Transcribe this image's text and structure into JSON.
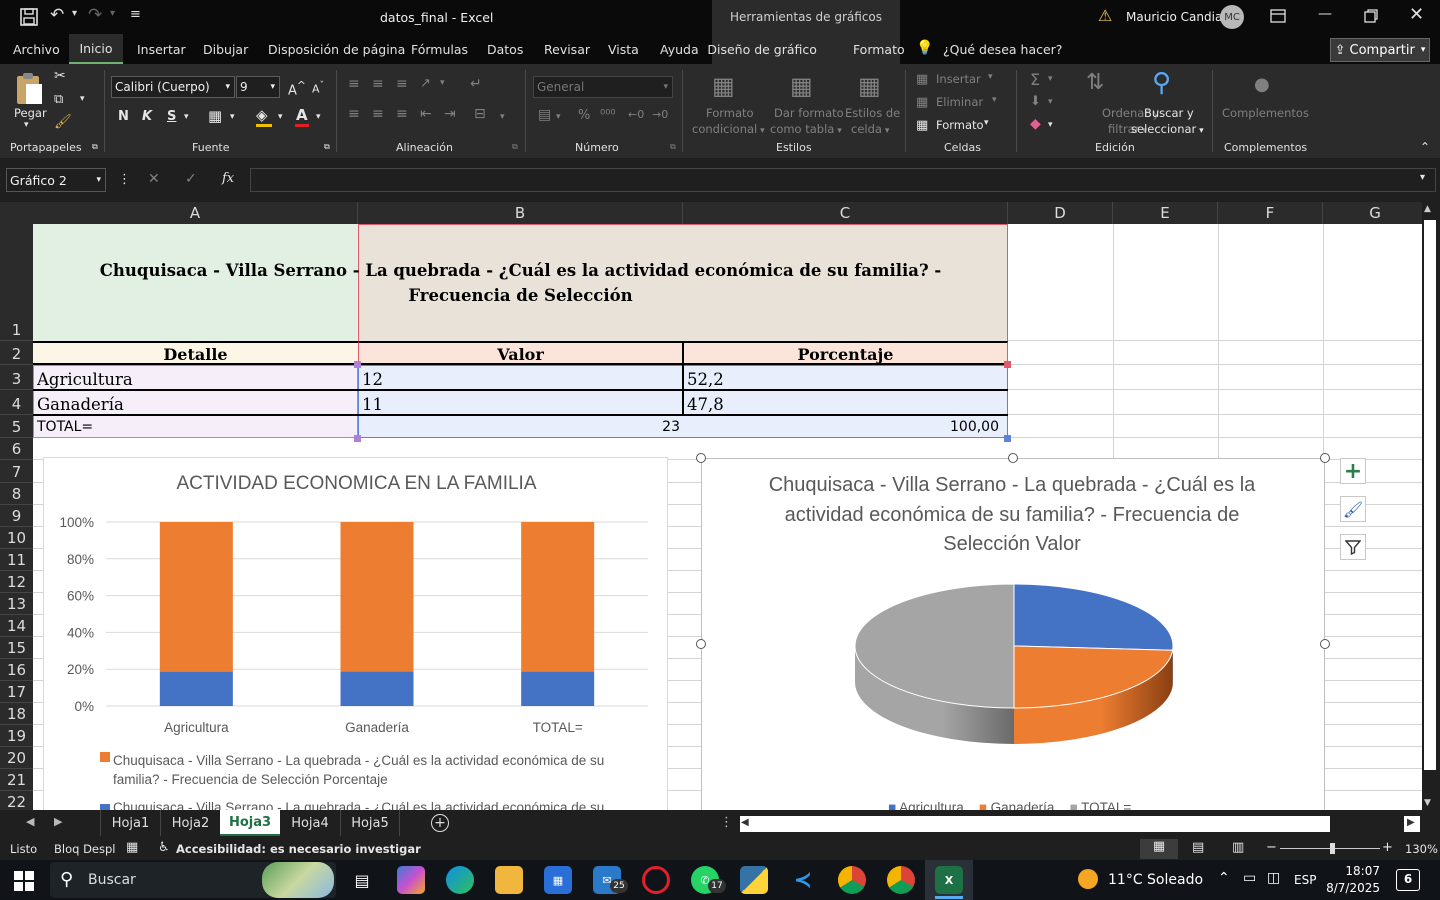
{
  "window": {
    "doc_title": "datos_final  -  Excel",
    "context_title": "Herramientas de gráficos",
    "user": "Mauricio Candia",
    "user_initials": "MC"
  },
  "tabs": [
    "Archivo",
    "Inicio",
    "Insertar",
    "Dibujar",
    "Disposición de página",
    "Fórmulas",
    "Datos",
    "Revisar",
    "Vista",
    "Ayuda",
    "Diseño de gráfico",
    "Formato"
  ],
  "tell_me": "¿Qué desea hacer?",
  "share": "Compartir",
  "ribbon": {
    "paste": "Pegar",
    "font_name": "Calibri (Cuerpo)",
    "font_size": "9",
    "bold": "N",
    "italic": "K",
    "underline": "S",
    "number_format": "General",
    "cond_format": [
      "Formato",
      "condicional"
    ],
    "format_table": [
      "Dar formato",
      "como tabla"
    ],
    "cell_styles": [
      "Estilos de",
      "celda"
    ],
    "insert": "Insertar",
    "delete": "Eliminar",
    "format": "Formato",
    "sort_filter": [
      "Ordenar y",
      "filtrar"
    ],
    "find_select": [
      "Buscar y",
      "seleccionar"
    ],
    "addins": "Complementos",
    "groups": [
      "Portapapeles",
      "Fuente",
      "Alineación",
      "Número",
      "Estilos",
      "Celdas",
      "Edición",
      "Complementos"
    ]
  },
  "name_box": "Gráfico 2",
  "fx": "fx",
  "columns": [
    "A",
    "B",
    "C",
    "D",
    "E",
    "F",
    "G"
  ],
  "rows": [
    "1",
    "2",
    "3",
    "4",
    "5",
    "6",
    "7",
    "8",
    "9",
    "10",
    "11",
    "12",
    "13",
    "14",
    "15",
    "16",
    "17",
    "18",
    "19",
    "20",
    "21",
    "22"
  ],
  "sheet": {
    "title": "Chuquisaca - Villa Serrano - La quebrada - ¿Cuál es la actividad económica de su familia? - Frecuencia de Selección",
    "headers": [
      "Detalle",
      "Valor",
      "Porcentaje"
    ],
    "rows": [
      {
        "detalle": " Agricultura",
        "valor": "12",
        "porcentaje": "52,2"
      },
      {
        "detalle": "Ganadería",
        "valor": "11",
        "porcentaje": "47,8"
      }
    ],
    "total": {
      "label": "TOTAL=",
      "valor": "23",
      "porcentaje": "100,00"
    }
  },
  "chart_data": [
    {
      "type": "bar",
      "title": "ACTIVIDAD ECONOMICA EN LA FAMILIA",
      "categories": [
        "Agricultura",
        "Ganadería",
        "TOTAL="
      ],
      "yticks": [
        "100%",
        "80%",
        "60%",
        "40%",
        "20%",
        "0%"
      ],
      "stacked_percent": true,
      "series": [
        {
          "name": "Chuquisaca - Villa Serrano - La quebrada - ¿Cuál es la actividad económica de su familia? - Frecuencia de Selección Valor",
          "values": [
            12,
            11,
            23
          ],
          "color": "#4472c4"
        },
        {
          "name": "Chuquisaca - Villa Serrano - La quebrada - ¿Cuál es la actividad económica de su familia? - Frecuencia de Selección Porcentaje",
          "values": [
            52.2,
            47.8,
            100
          ],
          "color": "#ed7d31"
        }
      ],
      "legend_visible": [
        "Chuquisaca - Villa Serrano - La quebrada - ¿Cuál es la actividad económica de su familia? - Frecuencia de Selección Porcentaje",
        "Chuquisaca - Villa Serrano - La quebrada - ¿Cuál es la actividad económica de su familia? - Frecuencia de Selección Valor"
      ],
      "legend_position": "bottom"
    },
    {
      "type": "pie",
      "title": "Chuquisaca - Villa Serrano - La quebrada - ¿Cuál es la actividad económica de su familia? - Frecuencia de Selección Valor",
      "labels": [
        "Agricultura",
        "Ganadería",
        "TOTAL="
      ],
      "values": [
        12,
        11,
        23
      ],
      "colors": [
        "#4472c4",
        "#ed7d31",
        "#a5a5a5"
      ],
      "legend_position": "bottom"
    }
  ],
  "sheet_tabs": [
    "Hoja1",
    "Hoja2",
    "Hoja3",
    "Hoja4",
    "Hoja5"
  ],
  "active_sheet": "Hoja3",
  "status": {
    "ready": "Listo",
    "caps": "Bloq Despl",
    "accessibility": "Accesibilidad: es necesario investigar",
    "zoom": "130%"
  },
  "taskbar": {
    "search": "Buscar",
    "weather": "11°C  Soleado",
    "lang": "ESP",
    "time": "18:07",
    "date": "8/7/2025",
    "mail_badge": "25",
    "wa_badge": "17",
    "notif": "6"
  }
}
